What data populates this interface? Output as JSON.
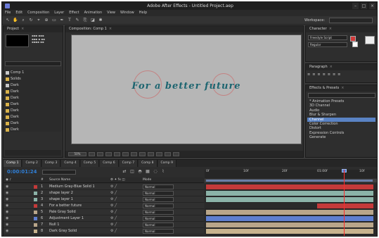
{
  "window": {
    "title": "Adobe After Effects - Untitled Project.aep"
  },
  "menus": [
    "File",
    "Edit",
    "Composition",
    "Layer",
    "Effect",
    "Animation",
    "View",
    "Window",
    "Help"
  ],
  "toolbar": {
    "workspace_label": "Workspace:"
  },
  "project": {
    "tab": "Project",
    "items": [
      "Comp 1",
      "Solids",
      "Dark",
      "Dark",
      "Dark",
      "Dark",
      "Dark",
      "Dark",
      "Dark",
      "Dark"
    ]
  },
  "composition": {
    "tab": "Composition: Comp 1",
    "text": "For a better future",
    "zoom": "50%"
  },
  "character": {
    "tab": "Character",
    "font": "Freestyle Script",
    "style": "Regular",
    "fill_color": "#d23a3a",
    "stroke_color": "#ffffff"
  },
  "paragraph": {
    "tab": "Paragraph"
  },
  "effects": {
    "tab": "Effects & Presets",
    "items": [
      "* Animation Presets",
      "3D Channel",
      "Audio",
      "Blur & Sharpen",
      "Channel",
      "Color Correction",
      "Distort",
      "Expression Controls",
      "Generate"
    ]
  },
  "timeline": {
    "tabs": [
      "Comp 1",
      "Comp 2",
      "Comp 3",
      "Comp 4",
      "Comp 5",
      "Comp 6",
      "Comp 7",
      "Comp 8",
      "Comp 9"
    ],
    "timecode": "0:00:01:24",
    "columns": {
      "num": "#",
      "source": "Source Name",
      "mode": "Mode"
    },
    "ruler": [
      "0f",
      "10f",
      "20f",
      "01:00f",
      "10f"
    ],
    "layers": [
      {
        "num": "1",
        "name": "Medium Gray-Blue Solid 1",
        "mode": "Normal",
        "color": "#c43a3a"
      },
      {
        "num": "2",
        "name": "shape layer 2",
        "mode": "Normal",
        "color": "#8bb3a8"
      },
      {
        "num": "3",
        "name": "shape layer 1",
        "mode": "Normal",
        "color": "#8bb3a8"
      },
      {
        "num": "4",
        "name": "For a better future",
        "mode": "Normal",
        "color": "#c43a3a"
      },
      {
        "num": "5",
        "name": "Pale Gray Solid",
        "mode": "Normal",
        "color": "#b9a68a"
      },
      {
        "num": "6",
        "name": "Adjustment Layer 1",
        "mode": "Normal",
        "color": "#5f7fd0"
      },
      {
        "num": "7",
        "name": "Null 1",
        "mode": "Normal",
        "color": "#b9a68a"
      },
      {
        "num": "8",
        "name": "Dark Gray Solid",
        "mode": "Normal",
        "color": "#c7b38e"
      }
    ]
  }
}
